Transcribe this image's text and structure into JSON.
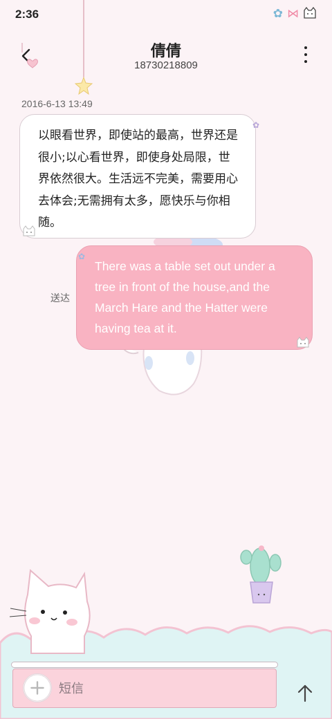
{
  "status_bar": {
    "time": "2:36",
    "icons": [
      "flower-icon",
      "bow-icon",
      "cat-icon"
    ]
  },
  "header": {
    "contact_name": "倩倩",
    "phone_number": "18730218809"
  },
  "conversation": {
    "timestamp": "2016-6-13 13:49",
    "incoming_message": "以眼看世界，即使站的最高，世界还是很小;以心看世界，即使身处局限，世界依然很大。生活远不完美，需要用心去体会;无需拥有太多，愿快乐与你相随。",
    "outgoing_message": "There was a table set out under a tree in front of the house,and the March Hare and the Hatter were having tea at it.",
    "delivery_status": "送达"
  },
  "composer": {
    "placeholder": "短信"
  },
  "colors": {
    "background": "#fcf3f6",
    "outgoing_bubble": "#f9b3c2",
    "incoming_bubble": "#ffffff",
    "cloud": "#dff4f4",
    "composer": "#fbd3dc"
  }
}
